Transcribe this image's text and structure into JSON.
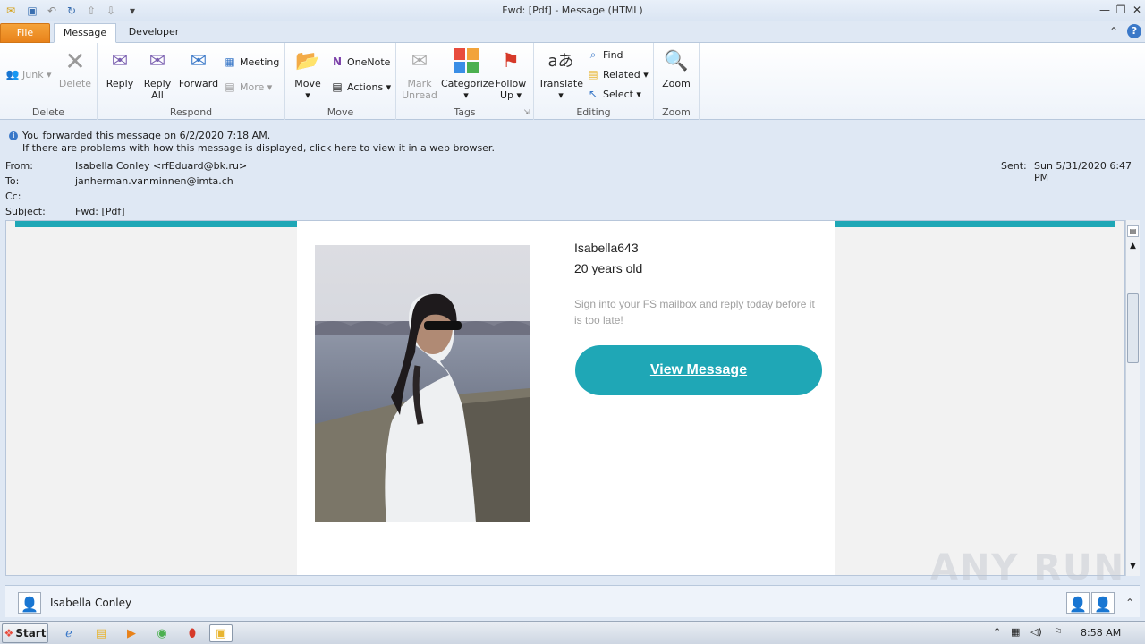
{
  "window": {
    "title": "Fwd: [Pdf]   - Message (HTML)"
  },
  "tabs": [
    {
      "label": "File"
    },
    {
      "label": "Message"
    },
    {
      "label": "Developer"
    }
  ],
  "ribbon": {
    "delete_group": {
      "label": "Delete",
      "junk": "Junk",
      "delete": "Delete"
    },
    "respond_group": {
      "label": "Respond",
      "reply": "Reply",
      "reply_all_1": "Reply",
      "reply_all_2": "All",
      "forward": "Forward",
      "meeting": "Meeting",
      "more": "More"
    },
    "move_group": {
      "label": "Move",
      "move": "Move",
      "onenote": "OneNote",
      "actions": "Actions"
    },
    "tags_group": {
      "label": "Tags",
      "mark_unread_1": "Mark",
      "mark_unread_2": "Unread",
      "categorize": "Categorize",
      "follow_up_1": "Follow",
      "follow_up_2": "Up"
    },
    "editing_group": {
      "label": "Editing",
      "translate": "Translate",
      "find": "Find",
      "related": "Related",
      "select": "Select"
    },
    "zoom_group": {
      "label": "Zoom",
      "zoom": "Zoom"
    }
  },
  "infobar": {
    "line1": "You forwarded this message on 6/2/2020 7:18 AM.",
    "line2": "If there are problems with how this message is displayed, click here to view it in a web browser."
  },
  "header": {
    "from_label": "From:",
    "from_value": "Isabella Conley <rfEduard@bk.ru>",
    "to_label": "To:",
    "to_value": "janherman.vanminnen@imta.ch",
    "cc_label": "Cc:",
    "subject_label": "Subject:",
    "subject_value": "Fwd: [Pdf]",
    "sent_label": "Sent:",
    "sent_value": "Sun 5/31/2020 6:47 PM"
  },
  "email": {
    "name": "Isabella643",
    "age": "20 years old",
    "prompt": "Sign into your FS mailbox and reply today before it is too late!",
    "button": "View Message"
  },
  "people": {
    "name": "Isabella Conley"
  },
  "taskbar": {
    "start": "Start",
    "clock": "8:58 AM"
  },
  "watermark": "ANY RUN",
  "colors": {
    "accent": "#1fa7b6",
    "file_tab": "#e8821a"
  }
}
